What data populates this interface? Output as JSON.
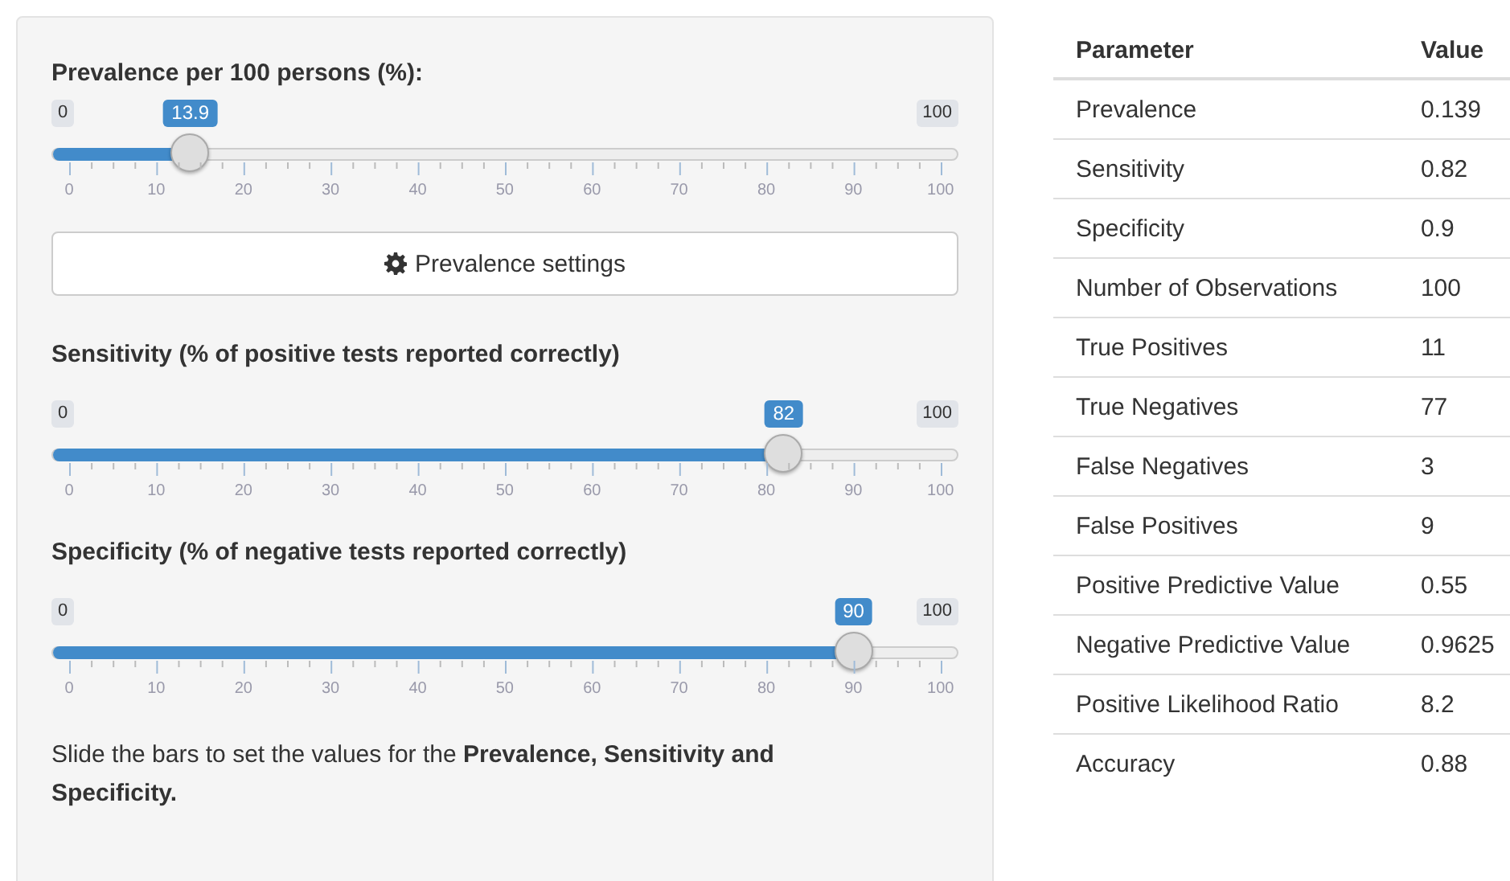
{
  "sliders": [
    {
      "label": "Prevalence per 100 persons (%):",
      "min_label": "0",
      "max_label": "100",
      "value_label": "13.9",
      "level": 0.139,
      "ticks": [
        "0",
        "10",
        "20",
        "30",
        "40",
        "50",
        "60",
        "70",
        "80",
        "90",
        "100"
      ]
    },
    {
      "label": "Sensitivity (% of positive tests reported correctly)",
      "min_label": "0",
      "max_label": "100",
      "value_label": "82",
      "level": 0.82,
      "ticks": [
        "0",
        "10",
        "20",
        "30",
        "40",
        "50",
        "60",
        "70",
        "80",
        "90",
        "100"
      ]
    },
    {
      "label": "Specificity (% of negative tests reported correctly)",
      "min_label": "0",
      "max_label": "100",
      "value_label": "90",
      "level": 0.9,
      "ticks": [
        "0",
        "10",
        "20",
        "30",
        "40",
        "50",
        "60",
        "70",
        "80",
        "90",
        "100"
      ]
    }
  ],
  "settings_button": {
    "label": "Prevalence settings"
  },
  "note": "Slide the bars to set the values for the **Prevalence, Sensitivity and Specificity.**",
  "table": {
    "columns": [
      "Parameter",
      "Value"
    ],
    "rows": [
      [
        "Prevalence",
        "0.139"
      ],
      [
        "Sensitivity",
        "0.82"
      ],
      [
        "Specificity",
        "0.9"
      ],
      [
        "Number of Observations",
        "100"
      ],
      [
        "True Positives",
        "11"
      ],
      [
        "True Negatives",
        "77"
      ],
      [
        "False Negatives",
        "3"
      ],
      [
        "False Positives",
        "9"
      ],
      [
        "Positive Predictive Value",
        "0.55"
      ],
      [
        "Negative Predictive Value",
        "0.9625"
      ],
      [
        "Positive Likelihood Ratio",
        "8.2"
      ],
      [
        "Accuracy",
        "0.88"
      ]
    ]
  }
}
